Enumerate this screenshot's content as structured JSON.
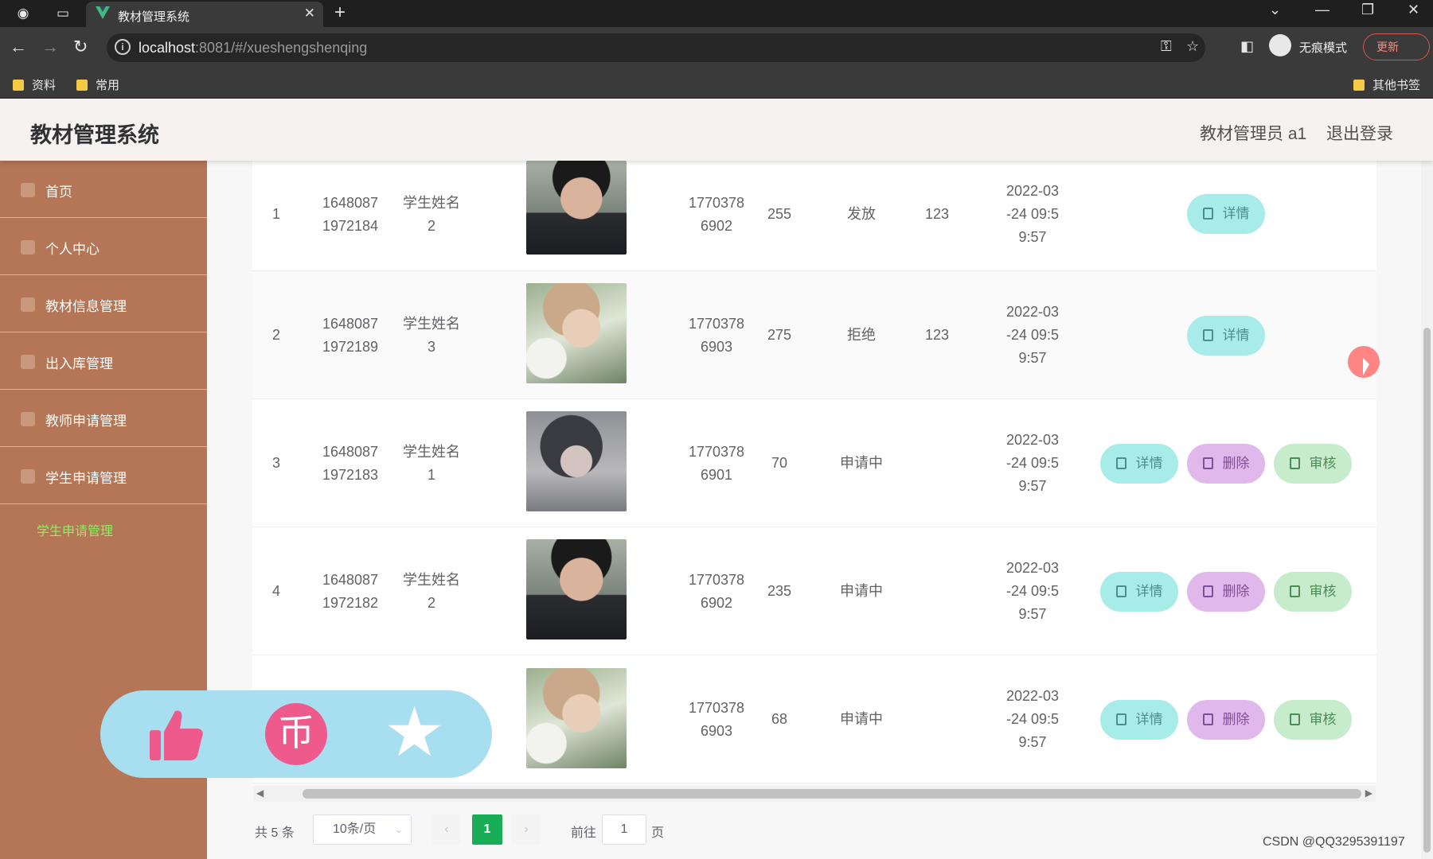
{
  "browser": {
    "tab_title": "教材管理系统",
    "new_tab": "+",
    "url_host": "localhost",
    "url_rest": ":8081/#/xueshengshenqing",
    "incognito_label": "无痕模式",
    "update_label": "更新",
    "bookmarks": [
      "资料",
      "常用"
    ],
    "other_bookmarks": "其他书签"
  },
  "header": {
    "title": "教材管理系统",
    "user": "教材管理员 a1",
    "logout": "退出登录"
  },
  "sidebar": {
    "items": [
      {
        "label": "首页",
        "icon": "home-icon"
      },
      {
        "label": "个人中心",
        "icon": "user-icon"
      },
      {
        "label": "教材信息管理",
        "icon": "book-icon"
      },
      {
        "label": "出入库管理",
        "icon": "warehouse-icon"
      },
      {
        "label": "教师申请管理",
        "icon": "teacher-icon"
      },
      {
        "label": "学生申请管理",
        "icon": "student-icon"
      }
    ],
    "sub_item": "学生申请管理"
  },
  "table": {
    "rows": [
      {
        "index": "1",
        "student_id": "1648087\n1972184",
        "name": "学生姓名\n2",
        "phone": "1770378\n6902",
        "quantity": "255",
        "status": "发放",
        "reply": "123",
        "time": "2022-03\n-24 09:5\n9:57",
        "actions": [
          "详情"
        ]
      },
      {
        "index": "2",
        "student_id": "1648087\n1972189",
        "name": "学生姓名\n3",
        "phone": "1770378\n6903",
        "quantity": "275",
        "status": "拒绝",
        "reply": "123",
        "time": "2022-03\n-24 09:5\n9:57",
        "actions": [
          "详情"
        ]
      },
      {
        "index": "3",
        "student_id": "1648087\n1972183",
        "name": "学生姓名\n1",
        "phone": "1770378\n6901",
        "quantity": "70",
        "status": "申请中",
        "reply": "",
        "time": "2022-03\n-24 09:5\n9:57",
        "actions": [
          "详情",
          "删除",
          "审核"
        ]
      },
      {
        "index": "4",
        "student_id": "1648087\n1972182",
        "name": "学生姓名\n2",
        "phone": "1770378\n6902",
        "quantity": "235",
        "status": "申请中",
        "reply": "",
        "time": "2022-03\n-24 09:5\n9:57",
        "actions": [
          "详情",
          "删除",
          "审核"
        ]
      },
      {
        "index": "",
        "student_id": "",
        "name": "",
        "phone": "1770378\n6903",
        "quantity": "68",
        "status": "申请中",
        "reply": "",
        "time": "2022-03\n-24 09:5\n9:57",
        "actions": [
          "详情",
          "删除",
          "审核"
        ]
      }
    ],
    "btn_detail": "详情",
    "btn_delete": "删除",
    "btn_audit": "审核"
  },
  "pagination": {
    "total": "共 5 条",
    "page_size": "10条/页",
    "current_page": "1",
    "goto_label": "前往",
    "goto_value": "1",
    "page_suffix": "页"
  },
  "watermark": "CSDN @QQ3295391197",
  "colors": {
    "sidebar_bg": "#b47656",
    "active_sub": "#8df061",
    "page_active": "#1aad57",
    "detail_btn": "#a8ece9",
    "delete_btn": "#e0b8ec",
    "audit_btn": "#c6eccc",
    "overlay": "#a8dff0"
  }
}
